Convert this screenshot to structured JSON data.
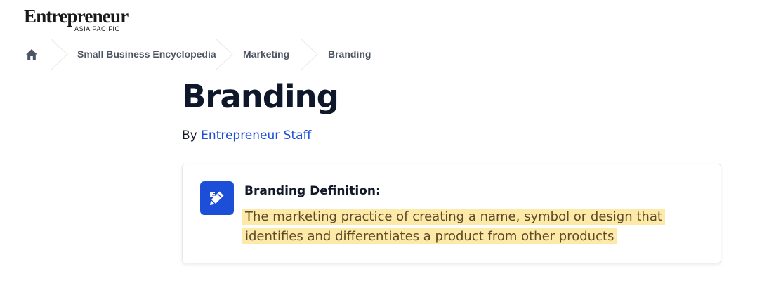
{
  "header": {
    "logo_main": "Entrepreneur",
    "logo_sub": "ASIA PACIFIC"
  },
  "breadcrumb": {
    "home_icon": "home-icon",
    "items": [
      {
        "label": "Small Business Encyclopedia"
      },
      {
        "label": "Marketing"
      },
      {
        "label": "Branding"
      }
    ]
  },
  "article": {
    "title": "Branding",
    "by_prefix": "By",
    "author": "Entrepreneur Staff"
  },
  "definition_card": {
    "icon": "pencil-ruler-icon",
    "heading": "Branding Definition:",
    "text": "The marketing practice of creating a name, symbol or design that identifies and differentiates a product from other products"
  },
  "colors": {
    "link": "#1d4ed8",
    "icon_bg": "#1d4ed8",
    "highlight": "#fde9a8",
    "title": "#0f172a"
  }
}
